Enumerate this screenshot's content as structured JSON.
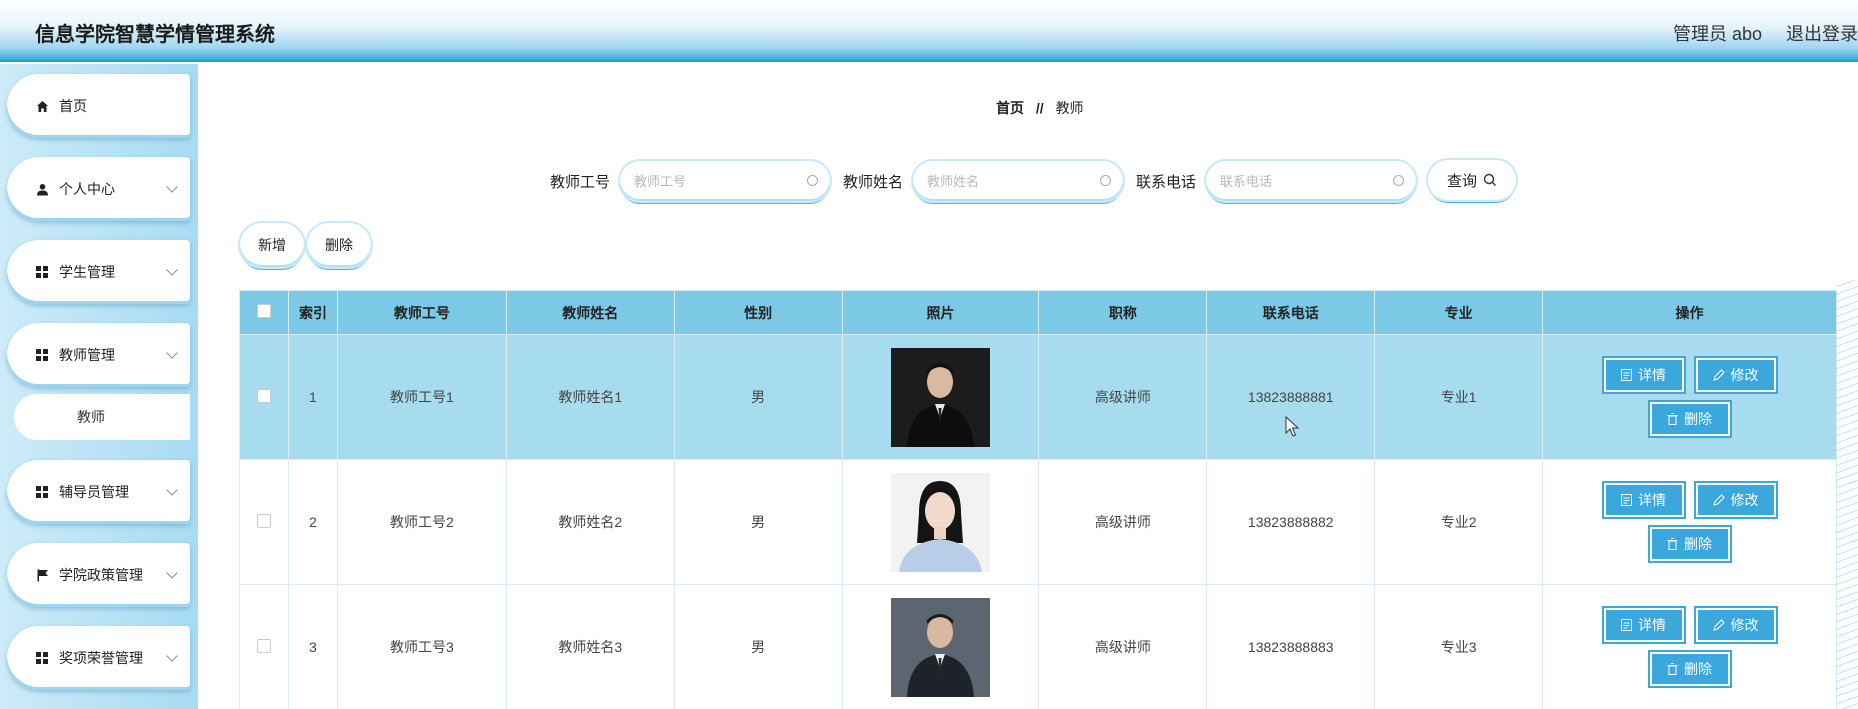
{
  "header": {
    "title": "信息学院智慧学情管理系统",
    "user": "管理员 abo",
    "logout": "退出登录"
  },
  "sidebar": {
    "items": [
      {
        "label": "首页",
        "icon": "home-icon"
      },
      {
        "label": "个人中心",
        "icon": "user-icon"
      },
      {
        "label": "学生管理",
        "icon": "grid-icon"
      },
      {
        "label": "教师管理",
        "icon": "grid-icon"
      },
      {
        "label": "辅导员管理",
        "icon": "grid-icon"
      },
      {
        "label": "学院政策管理",
        "icon": "flag-icon"
      },
      {
        "label": "奖项荣誉管理",
        "icon": "grid-icon"
      }
    ],
    "sub_item": "教师"
  },
  "breadcrumb": {
    "home": "首页",
    "sep": "//",
    "current": "教师"
  },
  "search": {
    "f1_label": "教师工号",
    "f1_placeholder": "教师工号",
    "f2_label": "教师姓名",
    "f2_placeholder": "教师姓名",
    "f3_label": "联系电话",
    "f3_placeholder": "联系电话",
    "query": "查询"
  },
  "toolbar": {
    "add": "新增",
    "delete": "删除"
  },
  "table": {
    "headers": [
      "索引",
      "教师工号",
      "教师姓名",
      "性别",
      "照片",
      "职称",
      "联系电话",
      "专业",
      "操作"
    ],
    "rows": [
      {
        "index": "1",
        "id": "教师工号1",
        "name": "教师姓名1",
        "gender": "男",
        "title": "高级讲师",
        "phone": "13823888881",
        "major": "专业1"
      },
      {
        "index": "2",
        "id": "教师工号2",
        "name": "教师姓名2",
        "gender": "男",
        "title": "高级讲师",
        "phone": "13823888882",
        "major": "专业2"
      },
      {
        "index": "3",
        "id": "教师工号3",
        "name": "教师姓名3",
        "gender": "男",
        "title": "高级讲师",
        "phone": "13823888883",
        "major": "专业3"
      }
    ],
    "actions": {
      "detail": "详情",
      "edit": "修改",
      "delete": "删除"
    }
  },
  "colors": {
    "accent": "#3aa8dc",
    "header_bar": "#7cc9e6",
    "selected_row": "#a6dcee"
  }
}
